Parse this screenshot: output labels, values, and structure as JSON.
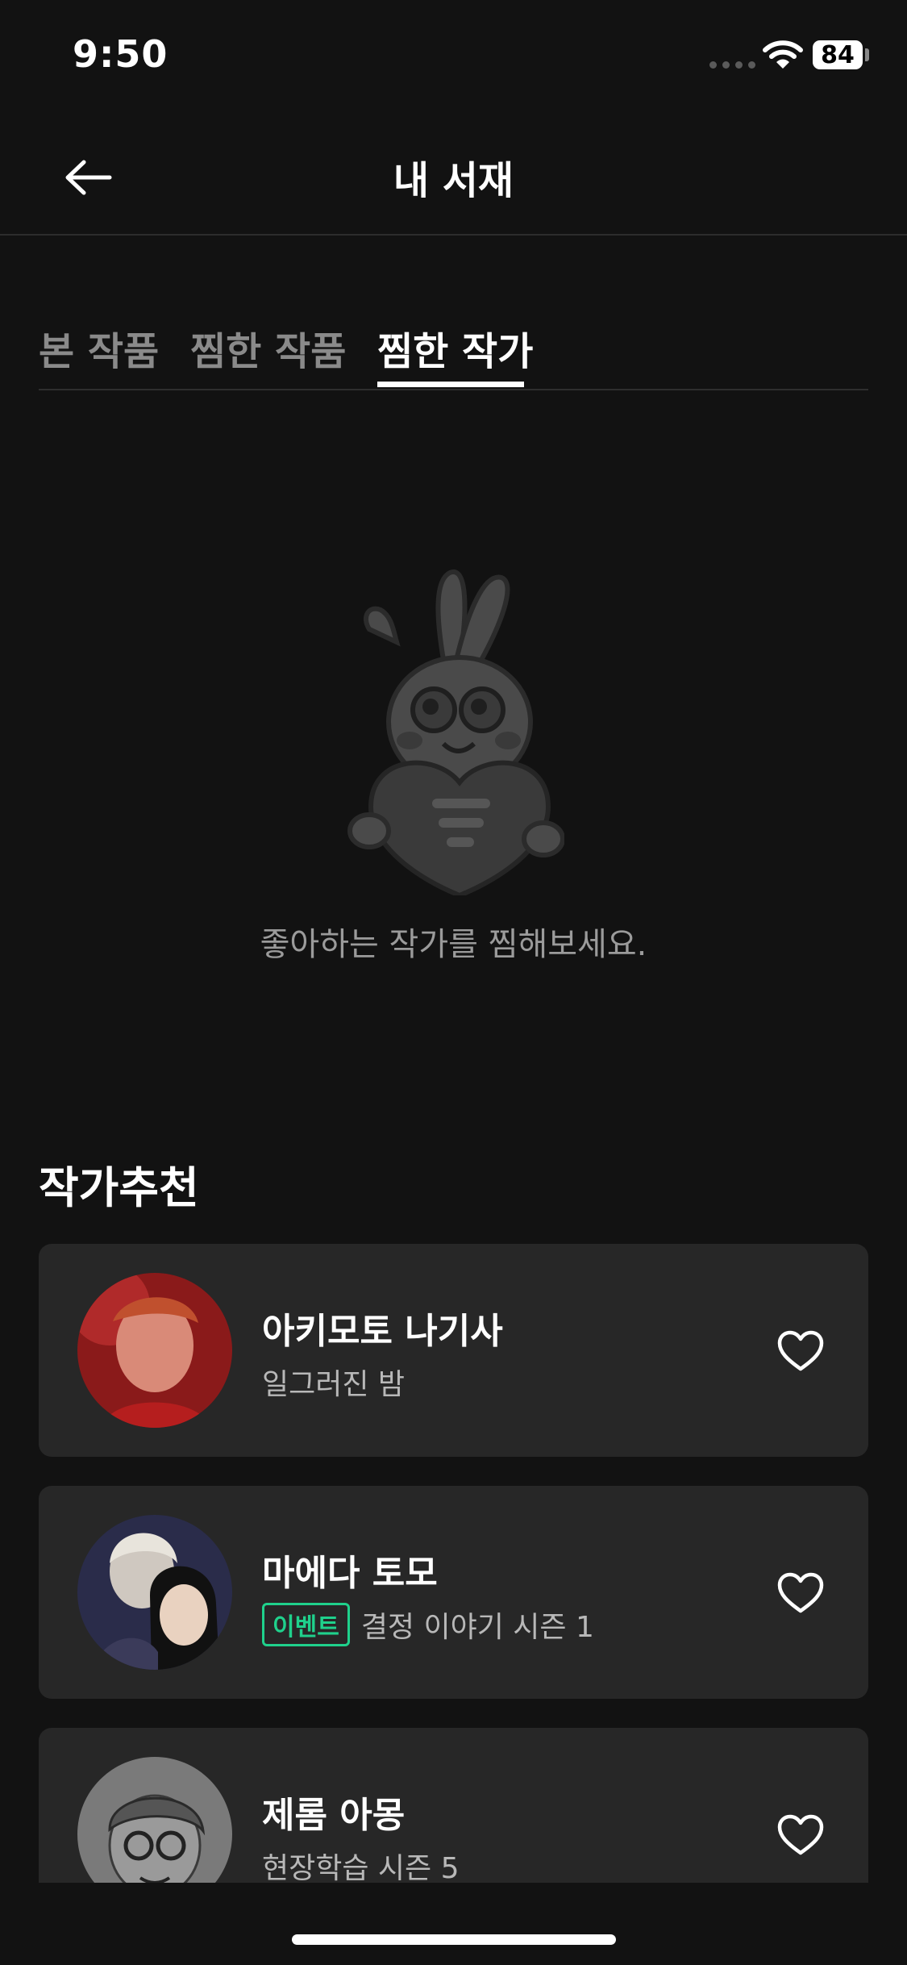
{
  "status_bar": {
    "time": "9:50",
    "battery": "84",
    "icons": [
      "signal-dots-icon",
      "wifi-icon",
      "battery-icon"
    ]
  },
  "header": {
    "title": "내 서재",
    "back_icon": "arrow-left-icon"
  },
  "tabs": [
    {
      "label": "본 작품",
      "active": false
    },
    {
      "label": "찜한 작품",
      "active": false
    },
    {
      "label": "찜한 작가",
      "active": true
    }
  ],
  "empty_state": {
    "illustration": "rabbit-heart-mascot",
    "message": "좋아하는 작가를 찜해보세요."
  },
  "recommendations": {
    "title": "작가추천",
    "authors": [
      {
        "name": "아키모토 나기사",
        "badge": "",
        "work": "일그러진 밤",
        "heart_icon": "heart-outline-icon"
      },
      {
        "name": "마에다 토모",
        "badge": "이벤트",
        "work": "결정 이야기 시즌 1",
        "heart_icon": "heart-outline-icon"
      },
      {
        "name": "제롬 아몽",
        "badge": "",
        "work": "현장학습 시즌 5",
        "heart_icon": "heart-outline-icon"
      }
    ]
  },
  "colors": {
    "background": "#121212",
    "card": "#272727",
    "accent": "#1fd18c",
    "inactive_text": "#8a8a8a"
  }
}
